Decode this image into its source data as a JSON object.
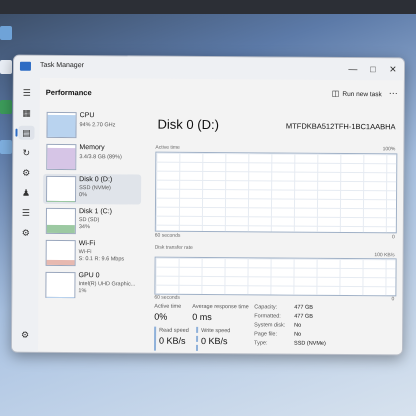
{
  "window": {
    "title": "Task Manager"
  },
  "header": {
    "page_title": "Performance",
    "run_new_task": "Run new task"
  },
  "sidebar": {
    "items": [
      {
        "name": "CPU",
        "line1": "94%  2.70 GHz",
        "line2": ""
      },
      {
        "name": "Memory",
        "line1": "3.4/3.8 GB (89%)",
        "line2": ""
      },
      {
        "name": "Disk 0 (D:)",
        "line1": "SSD (NVMe)",
        "line2": "0%"
      },
      {
        "name": "Disk 1 (C:)",
        "line1": "SD (SD)",
        "line2": "34%"
      },
      {
        "name": "Wi-Fi",
        "line1": "Wi-Fi",
        "line2": "S: 0.1  R: 9.6 Mbps"
      },
      {
        "name": "GPU 0",
        "line1": "Intel(R) UHD Graphic...",
        "line2": "1%"
      }
    ]
  },
  "main": {
    "title": "Disk 0 (D:)",
    "model": "MTFDKBA512TFH-1BC1AABHA",
    "graph1": {
      "label": "Active time",
      "max": "100%",
      "time": "60 seconds",
      "min": "0"
    },
    "graph2": {
      "label": "Disk transfer rate",
      "max": "100 KB/s",
      "time": "60 seconds",
      "min": "0"
    },
    "stats": {
      "active_time_label": "Active time",
      "active_time_value": "0%",
      "avg_response_label": "Average response time",
      "avg_response_value": "0 ms",
      "read_label": "Read speed",
      "read_value": "0 KB/s",
      "write_label": "Write speed",
      "write_value": "0 KB/s"
    },
    "details": [
      {
        "key": "Capacity:",
        "value": "477 GB"
      },
      {
        "key": "Formatted:",
        "value": "477 GB"
      },
      {
        "key": "System disk:",
        "value": "No"
      },
      {
        "key": "Page file:",
        "value": "No"
      },
      {
        "key": "Type:",
        "value": "SSD (NVMe)"
      }
    ]
  },
  "colors": {
    "accent": "#2d6cc4",
    "graph_border": "#9fb0c6"
  }
}
